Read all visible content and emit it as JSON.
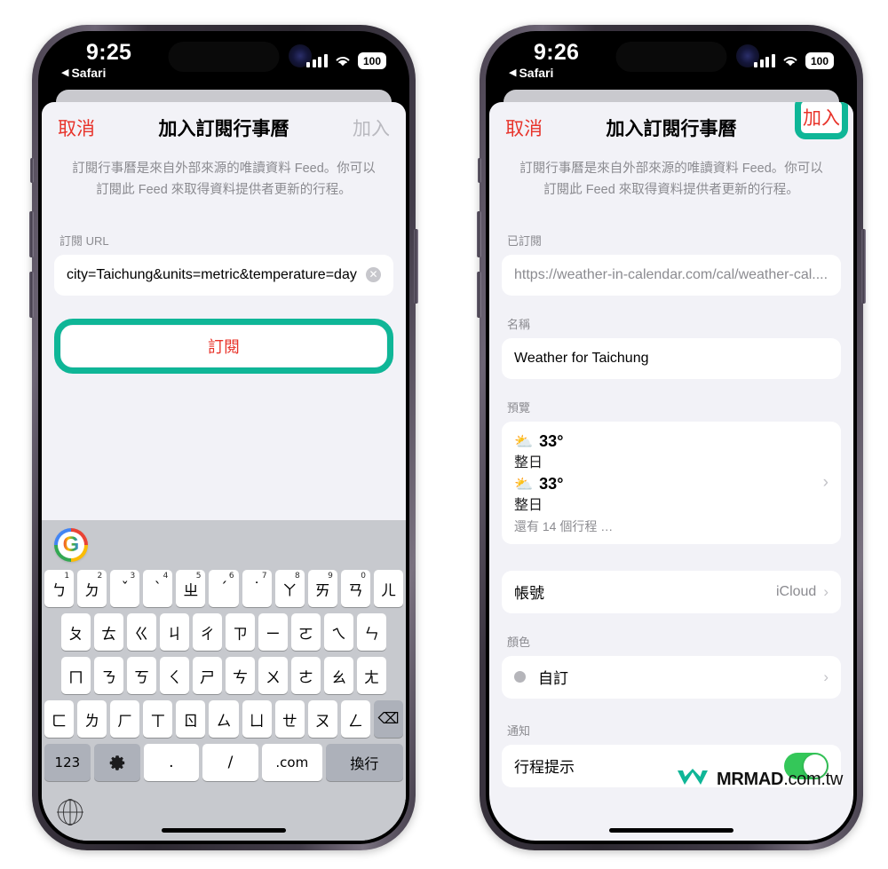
{
  "accent_color": "#0fb697",
  "left_phone": {
    "status_bar": {
      "time": "9:25",
      "back_app": "Safari",
      "back_arrow": "◀",
      "battery": "100",
      "icons": {
        "signal": "cellular-bars-icon",
        "wifi": "wifi-icon",
        "battery": "battery-icon"
      }
    },
    "nav": {
      "cancel": "取消",
      "title": "加入訂閱行事曆",
      "add": "加入"
    },
    "description": "訂閱行事曆是來自外部來源的唯讀資料 Feed。你可以訂閱此 Feed 來取得資料提供者更新的行程。",
    "url_field": {
      "label": "訂閱 URL",
      "value": "city=Taichung&units=metric&temperature=day",
      "clear_icon": "✕"
    },
    "subscribe_button": "訂閱",
    "keyboard": {
      "suggestion_logo": "google-logo-icon",
      "row1": [
        {
          "main": "ㄅ",
          "sup": "1"
        },
        {
          "main": "ㄉ",
          "sup": "2"
        },
        {
          "main": "ˇ",
          "sup": "3"
        },
        {
          "main": "ˋ",
          "sup": "4"
        },
        {
          "main": "ㄓ",
          "sup": "5"
        },
        {
          "main": "ˊ",
          "sup": "6"
        },
        {
          "main": "˙",
          "sup": "7"
        },
        {
          "main": "ㄚ",
          "sup": "8"
        },
        {
          "main": "ㄞ",
          "sup": "9"
        },
        {
          "main": "ㄢ",
          "sup": "0"
        },
        {
          "main": "ㄦ",
          "sup": ""
        }
      ],
      "row2": [
        "ㄆ",
        "ㄊ",
        "ㄍ",
        "ㄐ",
        "ㄔ",
        "ㄗ",
        "ㄧ",
        "ㄛ",
        "ㄟ",
        "ㄣ"
      ],
      "row3": [
        "ㄇ",
        "ㄋ",
        "ㄎ",
        "ㄑ",
        "ㄕ",
        "ㄘ",
        "ㄨ",
        "ㄜ",
        "ㄠ",
        "ㄤ"
      ],
      "row4": [
        "ㄈ",
        "ㄌ",
        "ㄏ",
        "ㄒ",
        "ㄖ",
        "ㄙ",
        "ㄩ",
        "ㄝ",
        "ㄡ",
        "ㄥ"
      ],
      "delete_key": "⌫",
      "bottom_row": {
        "numbers": "123",
        "gear": "⚙",
        "period": ".",
        "slash": "/",
        "dotcom": ".com",
        "enter": "換行"
      },
      "globe": "globe-icon"
    }
  },
  "right_phone": {
    "status_bar": {
      "time": "9:26",
      "back_app": "Safari",
      "back_arrow": "◀",
      "battery": "100"
    },
    "nav": {
      "cancel": "取消",
      "title": "加入訂閱行事曆",
      "add": "加入"
    },
    "description": "訂閱行事曆是來自外部來源的唯讀資料 Feed。你可以訂閱此 Feed 來取得資料提供者更新的行程。",
    "subscribed_field": {
      "label": "已訂閱",
      "value": "https://weather-in-calendar.com/cal/weather-cal...."
    },
    "name_field": {
      "label": "名稱",
      "value": "Weather for Taichung"
    },
    "preview": {
      "label": "預覽",
      "events": [
        {
          "icon": "⛅",
          "temp": "33°",
          "when": "整日"
        },
        {
          "icon": "⛅",
          "temp": "33°",
          "when": "整日"
        }
      ],
      "more": "還有 14 個行程 …",
      "chevron": "›"
    },
    "account_row": {
      "label": "帳號",
      "value": "iCloud",
      "chevron": "›"
    },
    "color_section": {
      "label": "顏色",
      "value": "自訂",
      "chevron": "›",
      "swatch": "gray"
    },
    "notify_section": {
      "label": "通知",
      "row_label": "行程提示",
      "toggle_on": true
    },
    "watermark": {
      "mark": "MRMAD",
      "suffix": ".com.tw",
      "logo": "mrmad-logo-icon"
    }
  }
}
